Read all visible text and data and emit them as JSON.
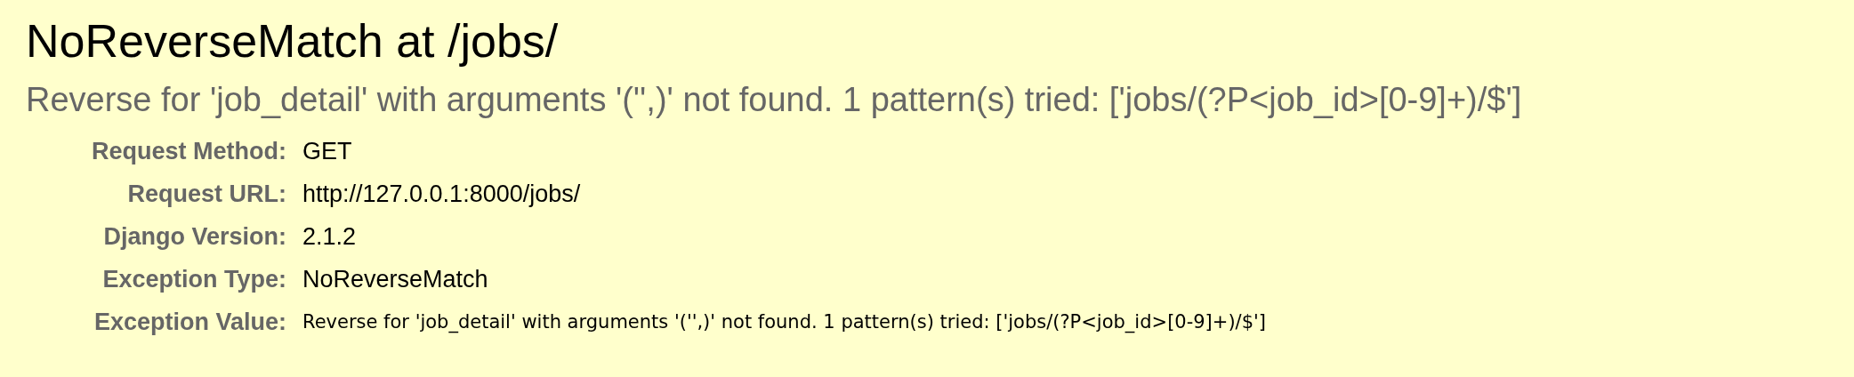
{
  "title": "NoReverseMatch at /jobs/",
  "subtitle": "Reverse for 'job_detail' with arguments '('',)' not found. 1 pattern(s) tried: ['jobs/(?P<job_id>[0-9]+)/$']",
  "summary": [
    {
      "label": "Request Method:",
      "value": "GET",
      "kind": "normal"
    },
    {
      "label": "Request URL:",
      "value": "http://127.0.0.1:8000/jobs/",
      "kind": "normal"
    },
    {
      "label": "Django Version:",
      "value": "2.1.2",
      "kind": "normal"
    },
    {
      "label": "Exception Type:",
      "value": "NoReverseMatch",
      "kind": "normal"
    },
    {
      "label": "Exception Value:",
      "value": "Reverse for 'job_detail' with arguments '('',)' not found. 1 pattern(s) tried: ['jobs/(?P<job_id>[0-9]+)/$']",
      "kind": "code"
    }
  ]
}
